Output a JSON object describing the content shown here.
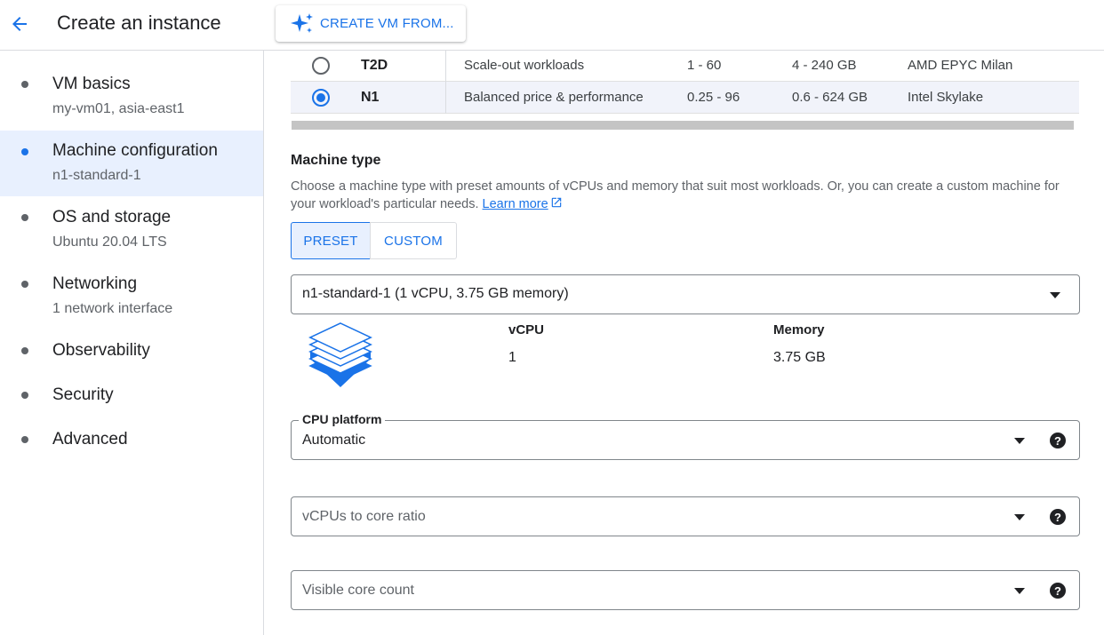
{
  "header": {
    "title": "Create an instance",
    "create_from_label": "CREATE VM FROM..."
  },
  "sidebar": {
    "items": [
      {
        "title": "VM basics",
        "subtitle": "my-vm01, asia-east1"
      },
      {
        "title": "Machine configuration",
        "subtitle": "n1-standard-1"
      },
      {
        "title": "OS and storage",
        "subtitle": "Ubuntu 20.04 LTS"
      },
      {
        "title": "Networking",
        "subtitle": "1 network interface"
      },
      {
        "title": "Observability"
      },
      {
        "title": "Security"
      },
      {
        "title": "Advanced"
      }
    ]
  },
  "series_table": {
    "rows": [
      {
        "series": "T2D",
        "description": "Scale-out workloads",
        "vcpus": "1 - 60",
        "memory": "4 - 240 GB",
        "platform": "AMD EPYC Milan",
        "selected": false
      },
      {
        "series": "N1",
        "description": "Balanced price & performance",
        "vcpus": "0.25 - 96",
        "memory": "0.6 - 624 GB",
        "platform": "Intel Skylake",
        "selected": true
      }
    ]
  },
  "machine_type": {
    "title": "Machine type",
    "description": "Choose a machine type with preset amounts of vCPUs and memory that suit most workloads. Or, you can create a custom machine for your workload's particular needs.",
    "learn_more": "Learn more",
    "preset_label": "PRESET",
    "custom_label": "CUSTOM",
    "selected_type": "n1-standard-1 (1 vCPU, 3.75 GB memory)",
    "vcpu_label": "vCPU",
    "vcpu_value": "1",
    "memory_label": "Memory",
    "memory_value": "3.75 GB"
  },
  "cpu_platform": {
    "label": "CPU platform",
    "value": "Automatic"
  },
  "vcpu_ratio": {
    "placeholder": "vCPUs to core ratio"
  },
  "visible_cores": {
    "placeholder": "Visible core count"
  },
  "colors": {
    "accent": "#1a73e8",
    "selected_bg": "#e8f0fe"
  },
  "icons": {
    "back": "arrow-left-icon",
    "create_from": "sparkle-icon",
    "stack": "machine-stack-icon",
    "help": "help-icon",
    "external": "open-in-new-icon",
    "dropdown": "caret-down-icon"
  }
}
